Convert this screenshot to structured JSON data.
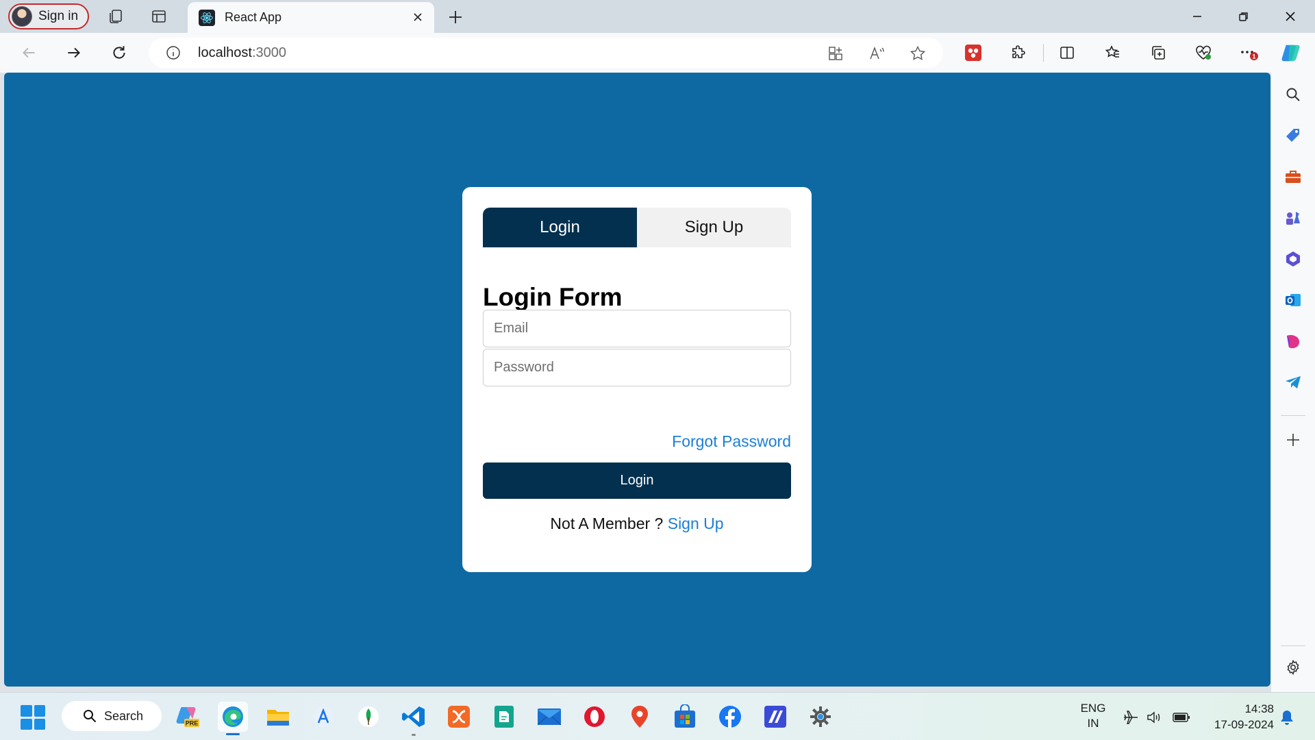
{
  "browser": {
    "profile_label": "Sign in",
    "tab_title": "React App",
    "url_host": "localhost",
    "url_port": ":3000",
    "notification_badge": "1"
  },
  "page": {
    "tabs": [
      {
        "label": "Login",
        "active": true
      },
      {
        "label": "Sign Up",
        "active": false
      }
    ],
    "form_title": "Login Form",
    "email_placeholder": "Email",
    "password_placeholder": "Password",
    "forgot_password": "Forgot Password",
    "login_button": "Login",
    "not_member_text": "Not A Member ?",
    "signup_link": "Sign Up"
  },
  "taskbar": {
    "search_label": "Search",
    "language_line1": "ENG",
    "language_line2": "IN",
    "time": "14:38",
    "date": "17-09-2024",
    "copilot_badge": "PRE"
  },
  "colors": {
    "page_background": "#0e69a3",
    "primary_dark": "#04304f",
    "link_blue": "#1b7fd6",
    "card_background": "#ffffff"
  }
}
